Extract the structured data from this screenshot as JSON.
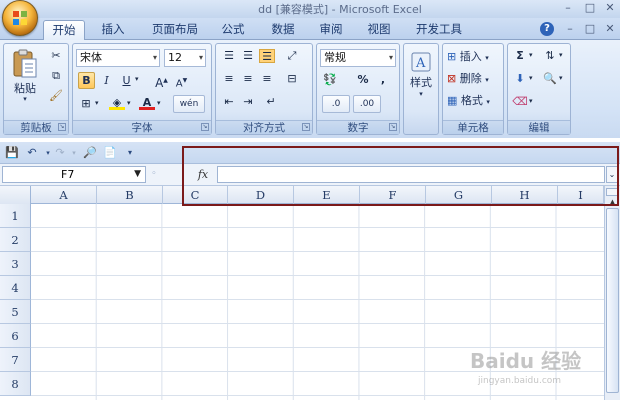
{
  "window": {
    "title": "dd [兼容模式] - Microsoft Excel",
    "min": "–",
    "max": "□",
    "close": "✕",
    "help": "?"
  },
  "tabs": [
    {
      "label": "开始",
      "active": true
    },
    {
      "label": "插入"
    },
    {
      "label": "页面布局"
    },
    {
      "label": "公式"
    },
    {
      "label": "数据"
    },
    {
      "label": "审阅"
    },
    {
      "label": "视图"
    },
    {
      "label": "开发工具"
    }
  ],
  "ribbon": {
    "clipboard": {
      "paste_label": "粘贴",
      "group_label": "剪贴板"
    },
    "font": {
      "font_name": "宋体",
      "font_size": "12",
      "bold": "B",
      "italic": "I",
      "underline": "U",
      "grow": "A",
      "shrink": "A",
      "color_letter": "A",
      "phonetic": "wén",
      "group_label": "字体"
    },
    "alignment": {
      "group_label": "对齐方式"
    },
    "number": {
      "format": "常规",
      "percent": "%",
      "comma": ",",
      "inc_dec": ".0",
      "inc_dec2": ".00",
      "group_label": "数字"
    },
    "styles": {
      "label": "样式"
    },
    "cells": {
      "insert": "插入",
      "delete": "删除",
      "format": "格式",
      "group_label": "单元格"
    },
    "editing": {
      "sigma": "Σ",
      "group_label": "编辑"
    }
  },
  "formula_bar": {
    "name_box": "F7",
    "fx": "fx",
    "value": ""
  },
  "columns": [
    "A",
    "B",
    "C",
    "D",
    "E",
    "F",
    "G",
    "H",
    "I"
  ],
  "rows": [
    "1",
    "2",
    "3",
    "4",
    "5",
    "6",
    "7",
    "8"
  ],
  "watermark": {
    "text": "Baidu 经验",
    "sub": "jingyan.baidu.com"
  },
  "colors": {
    "accent": "#1d3a6e",
    "highlight_frame": "#7b1a1a"
  }
}
